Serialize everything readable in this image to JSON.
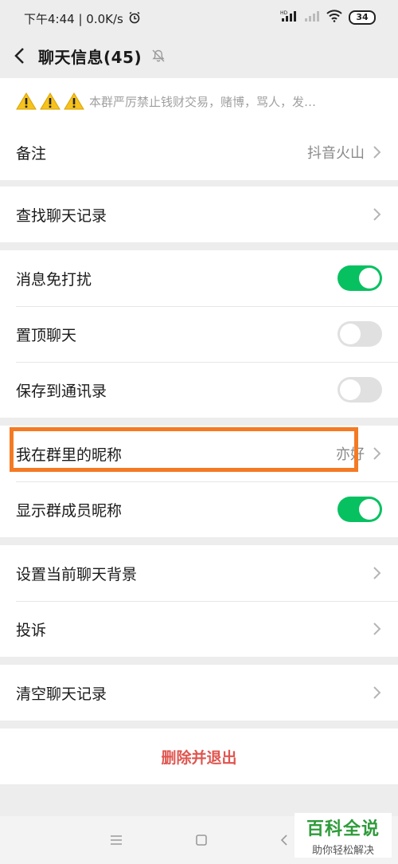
{
  "status": {
    "time_speed": "下午4:44 | 0.0K/s",
    "battery": "34"
  },
  "header": {
    "title": "聊天信息(45)"
  },
  "notice": {
    "text": "本群严厉禁止钱财交易，赌博，骂人，发…"
  },
  "settings": {
    "remark_label": "备注",
    "remark_value": "抖音火山",
    "search_history": "查找聊天记录",
    "mute_label": "消息免打扰",
    "mute_on": true,
    "pin_label": "置顶聊天",
    "pin_on": false,
    "save_contacts_label": "保存到通讯录",
    "save_contacts_on": false,
    "nickname_label": "我在群里的昵称",
    "nickname_value": "亦好",
    "show_nicknames_label": "显示群成员昵称",
    "show_nicknames_on": true,
    "background_label": "设置当前聊天背景",
    "complain_label": "投诉",
    "clear_label": "清空聊天记录",
    "delete_label": "删除并退出"
  },
  "watermark": {
    "title": "百科全说",
    "subtitle": "助你轻松解决"
  },
  "colors": {
    "toggle_on": "#07c160",
    "delete": "#e0554f",
    "highlight": "#f47a24"
  }
}
